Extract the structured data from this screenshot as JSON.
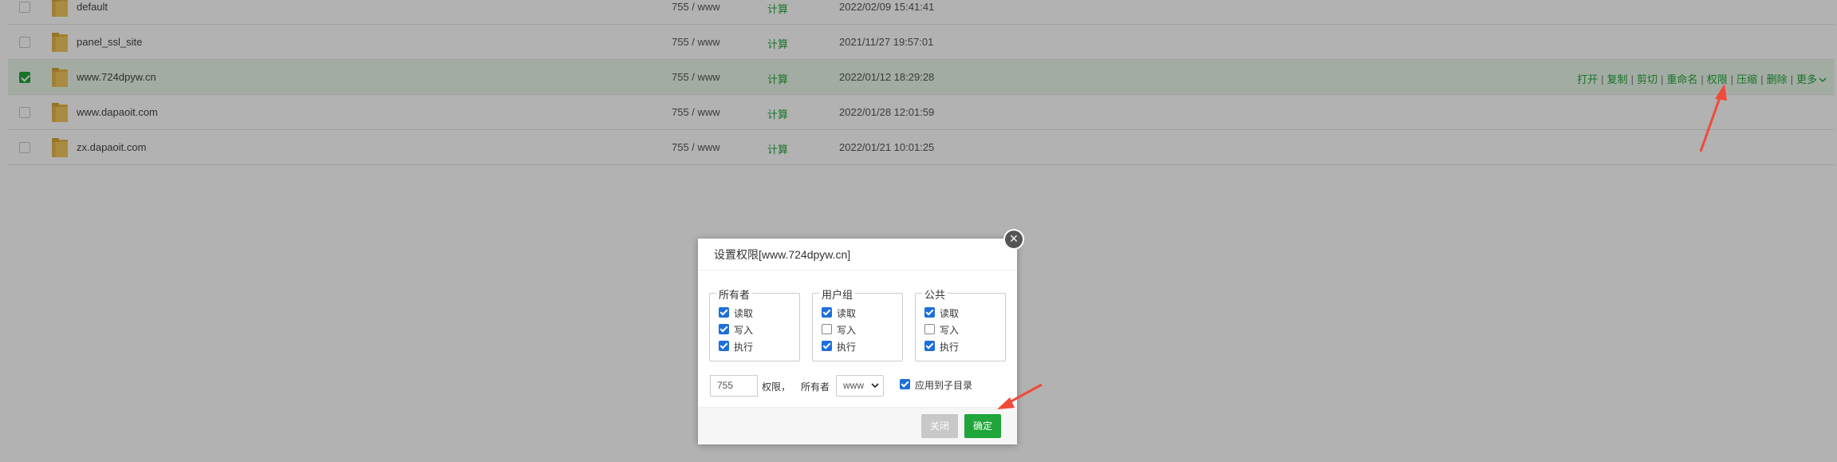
{
  "files": [
    {
      "name": "default",
      "permission": "755 / www",
      "size_action": "计算",
      "modified": "2022/02/09 15:41:41",
      "checked": false
    },
    {
      "name": "panel_ssl_site",
      "permission": "755 / www",
      "size_action": "计算",
      "modified": "2021/11/27 19:57:01",
      "checked": false
    },
    {
      "name": "www.724dpyw.cn",
      "permission": "755 / www",
      "size_action": "计算",
      "modified": "2022/01/12 18:29:28",
      "checked": true
    },
    {
      "name": "www.dapaoit.com",
      "permission": "755 / www",
      "size_action": "计算",
      "modified": "2022/01/28 12:01:59",
      "checked": false
    },
    {
      "name": "zx.dapaoit.com",
      "permission": "755 / www",
      "size_action": "计算",
      "modified": "2022/01/21 10:01:25",
      "checked": false
    }
  ],
  "row_actions": [
    "打开",
    "复制",
    "剪切",
    "重命名",
    "权限",
    "压缩",
    "删除",
    "更多"
  ],
  "row_action_separator": "|",
  "more_icon": "chevron-down-icon",
  "dialog": {
    "title": "设置权限[www.724dpyw.cn]",
    "close_icon": "×",
    "groups": [
      {
        "legend": "所有者",
        "read": "读取",
        "write": "写入",
        "exec": "执行",
        "read_checked": true,
        "write_checked": true,
        "exec_checked": true
      },
      {
        "legend": "用户组",
        "read": "读取",
        "write": "写入",
        "exec": "执行",
        "read_checked": true,
        "write_checked": false,
        "exec_checked": true
      },
      {
        "legend": "公共",
        "read": "读取",
        "write": "写入",
        "exec": "执行",
        "read_checked": true,
        "write_checked": false,
        "exec_checked": true
      }
    ],
    "permission_value": "755",
    "permission_label": "权限，",
    "owner_label": "所有者",
    "owner_value": "www",
    "apply_subdirs_label": "应用到子目录",
    "apply_subdirs_checked": true,
    "close_button": "关闭",
    "ok_button": "确定"
  },
  "colors": {
    "accent": "#20a53a",
    "annotation_arrow": "#f04a3a",
    "checkbox_blue": "#1e6fd9",
    "folder": "#e8b84a"
  }
}
